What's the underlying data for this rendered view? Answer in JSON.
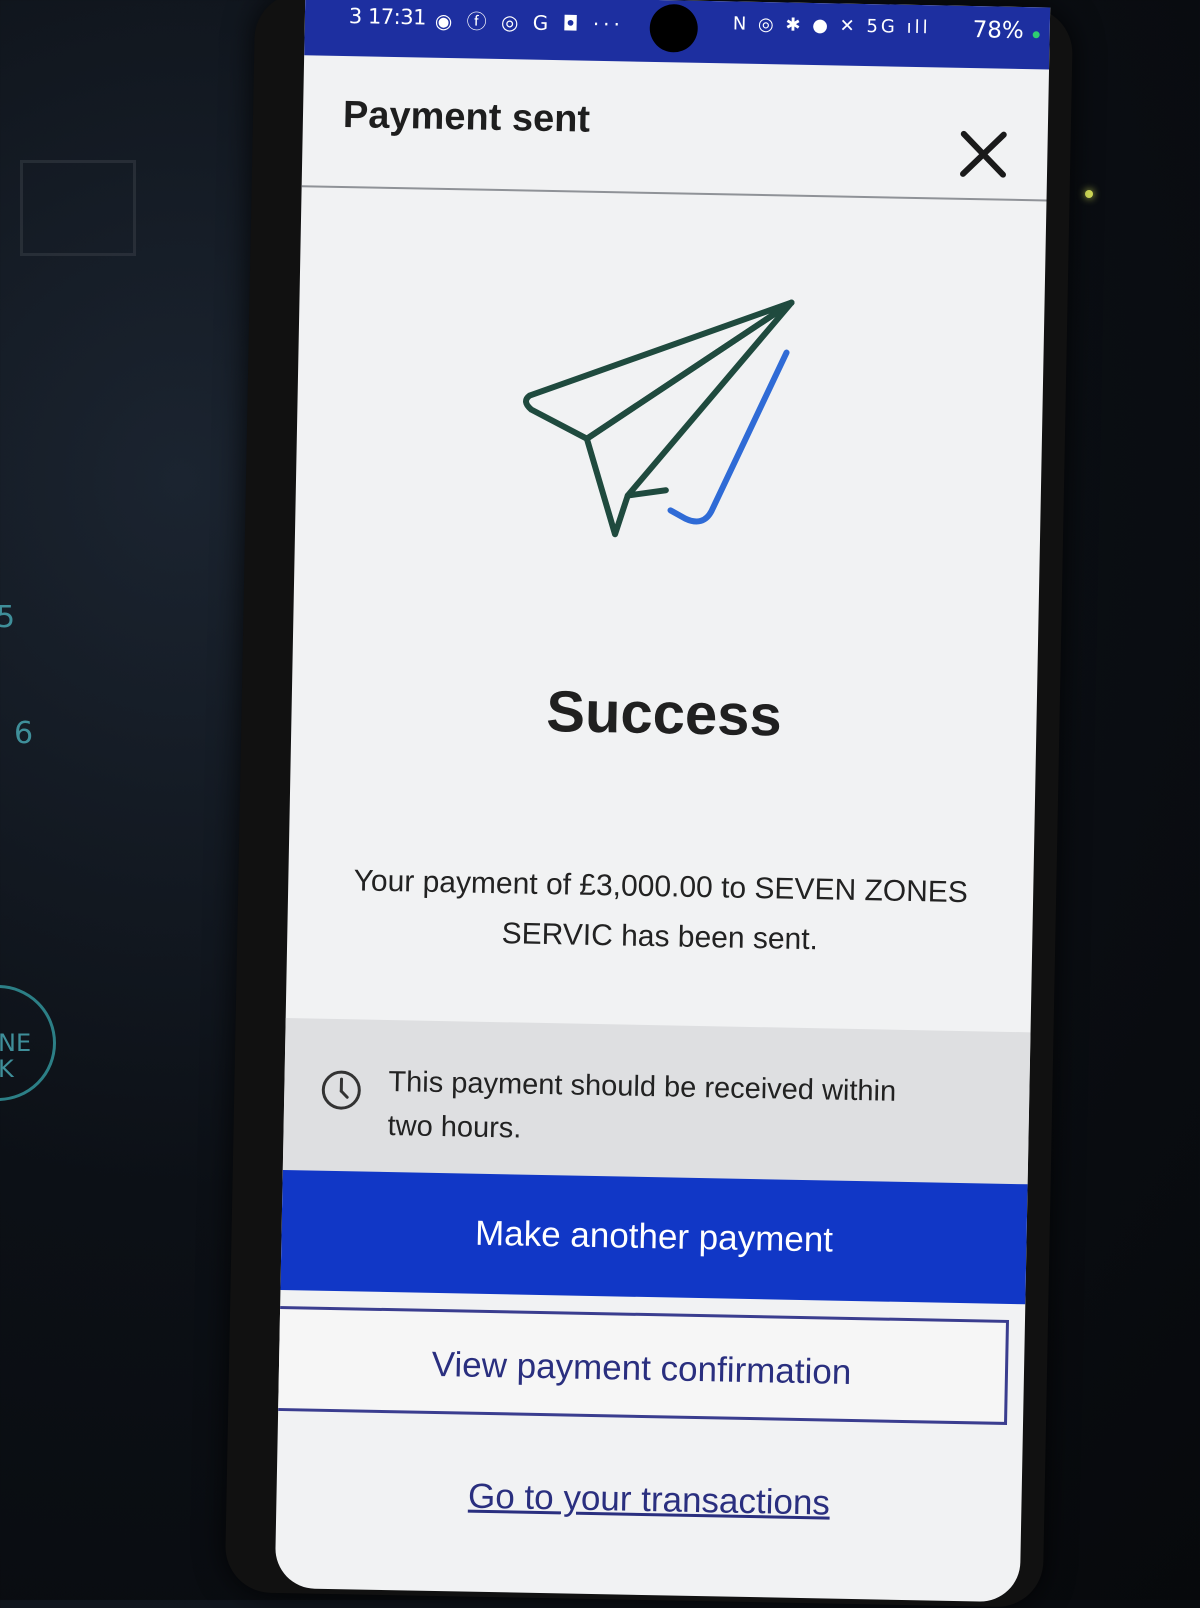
{
  "background": {
    "dashboard_numbers": [
      "5",
      "6"
    ],
    "ring_text": [
      "NE",
      "K"
    ]
  },
  "status_bar": {
    "time": "3 17:31",
    "notification_icons": "◉ ⓕ ◎ G ◘ ···",
    "system_icons": "N ◎ ✱ ● ✕ 5G ıll",
    "battery": "78%"
  },
  "header": {
    "title": "Payment sent",
    "close_icon": "close-icon"
  },
  "illustration": {
    "icon": "paper-plane-icon",
    "colors": {
      "plane": "#1f4a3e",
      "check": "#2f6bd6"
    }
  },
  "result": {
    "heading": "Success",
    "message": "Your payment of £3,000.00 to SEVEN ZONES SERVIC has been sent."
  },
  "info": {
    "icon": "clock-icon",
    "text": "This payment should be received within two hours."
  },
  "actions": {
    "primary_label": "Make another payment",
    "secondary_label": "View payment confirmation",
    "link_label": "Go to your transactions"
  },
  "colors": {
    "status_bar": "#1d2fa0",
    "primary_button": "#1137c6",
    "secondary_border": "#3a3d8f"
  }
}
